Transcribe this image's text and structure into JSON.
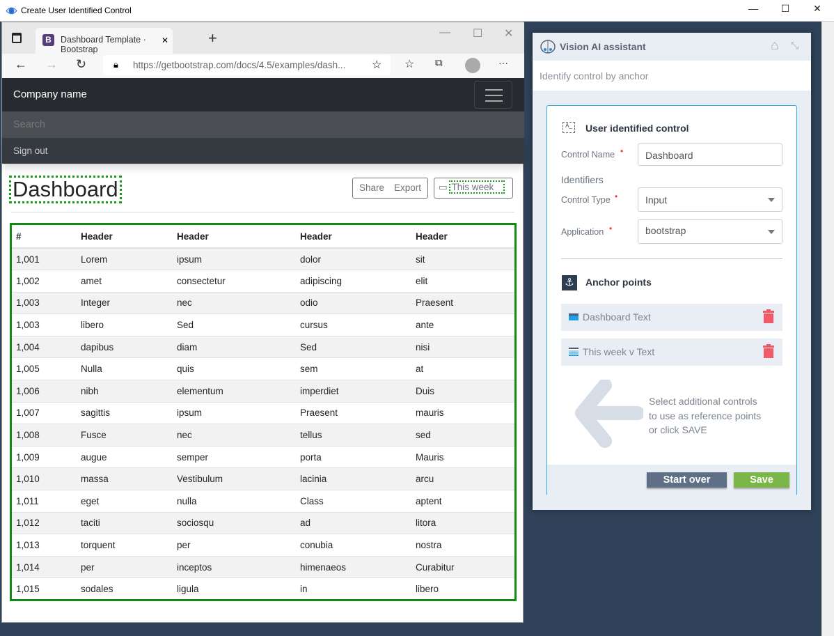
{
  "window": {
    "title": "Create User Identified Control",
    "minimize": "—",
    "maximize": "☐",
    "close": "✕"
  },
  "browser": {
    "tab_title": "Dashboard Template · Bootstrap",
    "tab_logo": "B",
    "tab_close": "✕",
    "new_tab": "+",
    "url": "https://getbootstrap.com/docs/4.5/examples/dash...",
    "more": "···"
  },
  "site": {
    "brand": "Company name",
    "search_placeholder": "Search",
    "sign_out": "Sign out",
    "page_title": "Dashboard",
    "share": "Share",
    "export": "Export",
    "period": "This week"
  },
  "table": {
    "headers": [
      "#",
      "Header",
      "Header",
      "Header",
      "Header"
    ],
    "rows": [
      [
        "1,001",
        "Lorem",
        "ipsum",
        "dolor",
        "sit"
      ],
      [
        "1,002",
        "amet",
        "consectetur",
        "adipiscing",
        "elit"
      ],
      [
        "1,003",
        "Integer",
        "nec",
        "odio",
        "Praesent"
      ],
      [
        "1,003",
        "libero",
        "Sed",
        "cursus",
        "ante"
      ],
      [
        "1,004",
        "dapibus",
        "diam",
        "Sed",
        "nisi"
      ],
      [
        "1,005",
        "Nulla",
        "quis",
        "sem",
        "at"
      ],
      [
        "1,006",
        "nibh",
        "elementum",
        "imperdiet",
        "Duis"
      ],
      [
        "1,007",
        "sagittis",
        "ipsum",
        "Praesent",
        "mauris"
      ],
      [
        "1,008",
        "Fusce",
        "nec",
        "tellus",
        "sed"
      ],
      [
        "1,009",
        "augue",
        "semper",
        "porta",
        "Mauris"
      ],
      [
        "1,010",
        "massa",
        "Vestibulum",
        "lacinia",
        "arcu"
      ],
      [
        "1,011",
        "eget",
        "nulla",
        "Class",
        "aptent"
      ],
      [
        "1,012",
        "taciti",
        "sociosqu",
        "ad",
        "litora"
      ],
      [
        "1,013",
        "torquent",
        "per",
        "conubia",
        "nostra"
      ],
      [
        "1,014",
        "per",
        "inceptos",
        "himenaeos",
        "Curabitur"
      ],
      [
        "1,015",
        "sodales",
        "ligula",
        "in",
        "libero"
      ]
    ]
  },
  "assistant": {
    "title": "Vision AI assistant",
    "subtitle": "Identify control by anchor",
    "section_title": "User identified control",
    "control_name_label": "Control Name",
    "control_name_value": "Dashboard",
    "identifiers_label": "Identifiers",
    "control_type_label": "Control Type",
    "control_type_value": "Input",
    "application_label": "Application",
    "application_value": "bootstrap",
    "required_mark": "•",
    "anchor_title": "Anchor points",
    "anchors": [
      "Dashboard Text",
      "This week v Text"
    ],
    "hint": [
      "Select additional controls",
      "to use as reference points",
      "or click SAVE"
    ],
    "start_over": "Start over",
    "save": "Save",
    "colors": {
      "accent": "#29a8e0",
      "save": "#7ab648",
      "start_over": "#5f6f86",
      "delete": "#f25a6a"
    }
  }
}
